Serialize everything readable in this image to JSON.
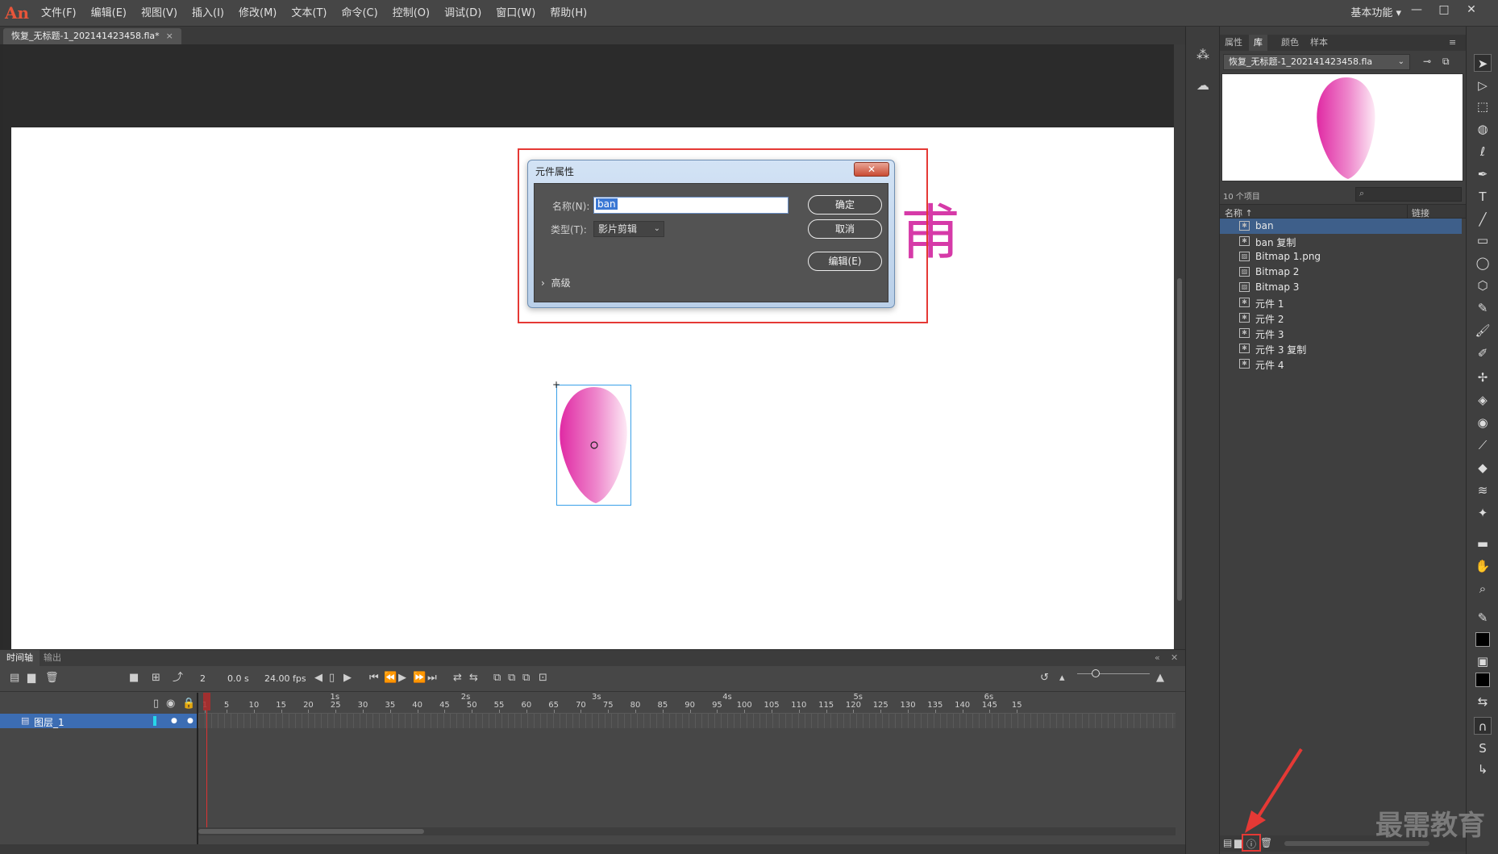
{
  "menubar": {
    "logo": "An",
    "items": [
      "文件(F)",
      "编辑(E)",
      "视图(V)",
      "插入(I)",
      "修改(M)",
      "文本(T)",
      "命令(C)",
      "控制(O)",
      "调试(D)",
      "窗口(W)",
      "帮助(H)"
    ],
    "workspace": "基本功能 ▾",
    "window_controls": [
      "—",
      "□",
      "✕"
    ]
  },
  "document": {
    "tab_title": "恢复_无标题-1_202141423458.fla*",
    "tab_close": "×"
  },
  "stage": {
    "ghost_char": "甫"
  },
  "dialog": {
    "title": "元件属性",
    "close": "✕",
    "name_label": "名称(N):",
    "name_value": "ban",
    "type_label": "类型(T):",
    "type_value": "影片剪辑",
    "ok": "确定",
    "cancel": "取消",
    "edit": "编辑(E)",
    "advanced": "高级",
    "advanced_chevron": "›"
  },
  "timeline": {
    "tabs": [
      "时间轴",
      "输出"
    ],
    "frame_number": "2",
    "time": "0.0 s",
    "fps": "24.00 fps",
    "ruler_numbers": [
      "1",
      "5",
      "10",
      "15",
      "20",
      "25",
      "30",
      "35",
      "40",
      "45",
      "50",
      "55",
      "60",
      "65",
      "70",
      "75",
      "80",
      "85",
      "90",
      "95",
      "100",
      "105",
      "110",
      "115",
      "120",
      "125",
      "130",
      "135",
      "140",
      "145",
      "15"
    ],
    "ruler_seconds": [
      "1s",
      "2s",
      "3s",
      "4s",
      "5s",
      "6s"
    ],
    "layer_name": "图层_1",
    "layer_color": "#27d7e9"
  },
  "library": {
    "tabs": [
      "属性",
      "库",
      "颜色",
      "样本"
    ],
    "active_tab": "库",
    "file": "恢复_无标题-1_202141423458.fla",
    "count": "10 个项目",
    "col_name": "名称 ↑",
    "col_link": "链接",
    "items": [
      {
        "name": "ban",
        "kind": "symbol"
      },
      {
        "name": "ban 复制",
        "kind": "symbol"
      },
      {
        "name": "Bitmap 1.png",
        "kind": "bitmap"
      },
      {
        "name": "Bitmap 2",
        "kind": "bitmap"
      },
      {
        "name": "Bitmap 3",
        "kind": "bitmap"
      },
      {
        "name": "元件 1",
        "kind": "symbol"
      },
      {
        "name": "元件 2",
        "kind": "symbol"
      },
      {
        "name": "元件 3",
        "kind": "symbol"
      },
      {
        "name": "元件 3 复制",
        "kind": "symbol"
      },
      {
        "name": "元件 4",
        "kind": "symbol"
      }
    ]
  },
  "colors": {
    "accent_red": "#e53935",
    "petal_pink": "#e03aa8",
    "layer_selected": "#3c6db3"
  },
  "watermark": "最需教育"
}
